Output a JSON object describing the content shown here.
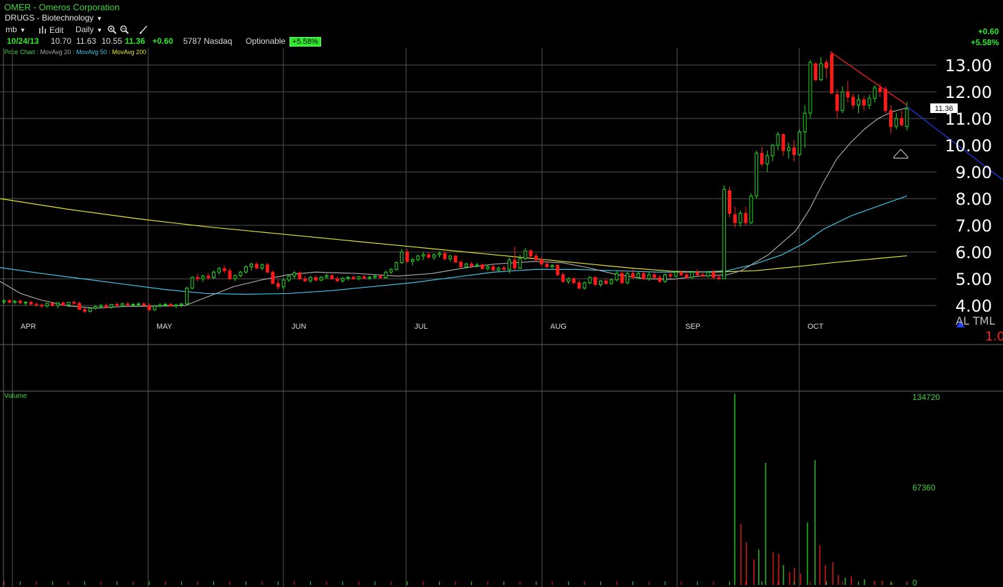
{
  "header": {
    "symbol": "OMER",
    "separator": "-",
    "company": "Omeros Corporation",
    "industry": "DRUGS - Biotechnology"
  },
  "toolbar": {
    "layout_label": "mb",
    "edit_label": "Edit",
    "period_label": "Daily"
  },
  "quote": {
    "date": "10/24/13",
    "open": "10.70",
    "high": "11.63",
    "low": "10.55",
    "last": "11.36",
    "change": "+0.60",
    "volume": "5787",
    "exchange": "Nasdaq",
    "optionable": "Optionable",
    "pct_change": "+5.58%"
  },
  "top_right": {
    "change": "+0.60",
    "pct_change": "+5.58%"
  },
  "legend": {
    "price": "Price Chart",
    "ma20": "MovAvg 20",
    "ma50": "MovAvg 50",
    "ma200": "MovAvg 200",
    "sep": ":"
  },
  "markers": {
    "al_tml": "AL TML",
    "ratio": "1.0",
    "current_price_tag": "11.36"
  },
  "colors": {
    "up": "#1fe01f",
    "down": "#ff1a1a",
    "ma20": "#a8a8a8",
    "ma50": "#3cc8e6",
    "ma200": "#e6e62a",
    "grid": "#555555",
    "trend_red": "#ff2020",
    "trend_blue": "#2040ff",
    "volume_label": "#3fd23f"
  },
  "chart_data": {
    "type": "candlestick",
    "title": "OMER - Omeros Corporation",
    "y_ticks": [
      "13.00",
      "12.00",
      "11.00",
      "10.00",
      "9.00",
      "8.00",
      "7.00",
      "6.00",
      "5.00",
      "4.00"
    ],
    "ylim": [
      3.8,
      13.6
    ],
    "month_labels": [
      "APR",
      "MAY",
      "JUN",
      "JUL",
      "AUG",
      "SEP",
      "OCT"
    ],
    "grid": true,
    "ohlc": [
      [
        4.14,
        4.22,
        4.05,
        4.18
      ],
      [
        4.18,
        4.24,
        4.08,
        4.12
      ],
      [
        4.12,
        4.2,
        4.04,
        4.16
      ],
      [
        4.16,
        4.22,
        4.06,
        4.1
      ],
      [
        4.1,
        4.16,
        4.0,
        4.12
      ],
      [
        4.12,
        4.18,
        4.02,
        4.05
      ],
      [
        4.05,
        4.12,
        3.94,
        4.02
      ],
      [
        4.02,
        4.08,
        3.9,
        3.98
      ],
      [
        3.98,
        4.1,
        3.92,
        4.08
      ],
      [
        4.08,
        4.14,
        3.96,
        4.0
      ],
      [
        4.0,
        4.12,
        3.9,
        4.1
      ],
      [
        4.1,
        4.16,
        3.98,
        4.02
      ],
      [
        4.02,
        4.14,
        3.94,
        4.12
      ],
      [
        4.12,
        4.2,
        4.04,
        4.08
      ],
      [
        4.08,
        4.14,
        3.86,
        3.85
      ],
      [
        3.85,
        3.92,
        3.72,
        3.78
      ],
      [
        3.78,
        3.92,
        3.74,
        3.9
      ],
      [
        3.9,
        4.0,
        3.84,
        3.96
      ],
      [
        3.96,
        4.06,
        3.9,
        4.0
      ],
      [
        4.0,
        4.08,
        3.9,
        3.94
      ],
      [
        3.94,
        4.06,
        3.88,
        4.04
      ],
      [
        4.04,
        4.12,
        3.96,
        4.0
      ],
      [
        4.0,
        4.1,
        3.94,
        4.06
      ],
      [
        4.06,
        4.14,
        3.98,
        4.02
      ],
      [
        4.02,
        4.1,
        3.94,
        4.04
      ],
      [
        4.04,
        4.12,
        3.96,
        4.06
      ],
      [
        4.06,
        4.12,
        3.98,
        4.0
      ],
      [
        4.0,
        4.08,
        3.8,
        3.84
      ],
      [
        3.84,
        4.0,
        3.8,
        3.98
      ],
      [
        3.98,
        4.08,
        3.92,
        4.02
      ],
      [
        4.02,
        4.1,
        3.96,
        4.04
      ],
      [
        4.04,
        4.1,
        3.96,
        3.98
      ],
      [
        3.98,
        4.06,
        3.9,
        4.02
      ],
      [
        4.02,
        4.08,
        3.94,
        4.06
      ],
      [
        4.06,
        4.7,
        4.02,
        4.65
      ],
      [
        4.65,
        5.1,
        4.6,
        5.05
      ],
      [
        5.05,
        5.2,
        4.9,
        5.0
      ],
      [
        5.0,
        5.15,
        4.88,
        5.1
      ],
      [
        5.1,
        5.22,
        4.96,
        5.04
      ],
      [
        5.04,
        5.3,
        5.0,
        5.25
      ],
      [
        5.25,
        5.45,
        5.15,
        5.38
      ],
      [
        5.38,
        5.5,
        5.2,
        5.3
      ],
      [
        5.3,
        5.4,
        4.95,
        5.0
      ],
      [
        5.0,
        5.16,
        4.9,
        5.12
      ],
      [
        5.12,
        5.3,
        5.06,
        5.25
      ],
      [
        5.25,
        5.5,
        5.2,
        5.45
      ],
      [
        5.45,
        5.6,
        5.3,
        5.55
      ],
      [
        5.55,
        5.62,
        5.35,
        5.4
      ],
      [
        5.4,
        5.58,
        5.32,
        5.52
      ],
      [
        5.52,
        5.6,
        5.2,
        5.25
      ],
      [
        5.25,
        5.3,
        4.8,
        4.82
      ],
      [
        4.82,
        5.0,
        4.6,
        4.7
      ],
      [
        4.7,
        5.0,
        4.6,
        4.95
      ],
      [
        4.95,
        5.15,
        4.88,
        5.1
      ],
      [
        5.1,
        5.3,
        5.0,
        5.22
      ],
      [
        5.22,
        5.28,
        4.95,
        5.0
      ],
      [
        5.0,
        5.1,
        4.88,
        4.92
      ],
      [
        4.92,
        5.1,
        4.86,
        5.05
      ],
      [
        5.05,
        5.12,
        4.9,
        4.95
      ],
      [
        4.95,
        5.1,
        4.9,
        5.06
      ],
      [
        5.06,
        5.2,
        5.0,
        5.12
      ],
      [
        5.12,
        5.18,
        4.95,
        5.0
      ],
      [
        5.0,
        5.08,
        4.88,
        4.92
      ],
      [
        4.92,
        5.06,
        4.86,
        5.02
      ],
      [
        5.02,
        5.1,
        4.94,
        5.06
      ],
      [
        5.06,
        5.12,
        4.96,
        5.0
      ],
      [
        5.0,
        5.1,
        4.94,
        5.08
      ],
      [
        5.08,
        5.14,
        4.98,
        5.02
      ],
      [
        5.02,
        5.1,
        4.96,
        5.06
      ],
      [
        5.06,
        5.16,
        5.0,
        5.1
      ],
      [
        5.1,
        5.16,
        5.0,
        5.04
      ],
      [
        5.04,
        5.3,
        5.0,
        5.25
      ],
      [
        5.25,
        5.4,
        5.18,
        5.35
      ],
      [
        5.35,
        5.65,
        5.3,
        5.6
      ],
      [
        5.6,
        6.1,
        5.55,
        6.0
      ],
      [
        6.0,
        6.1,
        5.6,
        5.65
      ],
      [
        5.65,
        5.78,
        5.5,
        5.72
      ],
      [
        5.72,
        5.9,
        5.65,
        5.85
      ],
      [
        5.85,
        6.0,
        5.7,
        5.9
      ],
      [
        5.9,
        6.0,
        5.75,
        5.8
      ],
      [
        5.8,
        5.95,
        5.7,
        5.9
      ],
      [
        5.9,
        6.02,
        5.8,
        5.95
      ],
      [
        5.95,
        6.02,
        5.7,
        5.75
      ],
      [
        5.75,
        5.9,
        5.65,
        5.85
      ],
      [
        5.85,
        5.9,
        5.6,
        5.62
      ],
      [
        5.62,
        5.7,
        5.4,
        5.45
      ],
      [
        5.45,
        5.6,
        5.38,
        5.55
      ],
      [
        5.55,
        5.62,
        5.4,
        5.48
      ],
      [
        5.48,
        5.6,
        5.42,
        5.52
      ],
      [
        5.52,
        5.58,
        5.35,
        5.38
      ],
      [
        5.38,
        5.5,
        5.3,
        5.45
      ],
      [
        5.45,
        5.52,
        5.3,
        5.32
      ],
      [
        5.32,
        5.45,
        5.26,
        5.4
      ],
      [
        5.4,
        5.5,
        5.3,
        5.35
      ],
      [
        5.35,
        5.8,
        5.2,
        5.7
      ],
      [
        5.7,
        6.2,
        5.3,
        5.4
      ],
      [
        5.4,
        5.9,
        5.36,
        5.75
      ],
      [
        5.75,
        6.15,
        5.7,
        6.05
      ],
      [
        6.05,
        6.1,
        5.8,
        5.85
      ],
      [
        5.85,
        5.95,
        5.65,
        5.72
      ],
      [
        5.72,
        5.8,
        5.5,
        5.55
      ],
      [
        5.55,
        5.62,
        5.4,
        5.45
      ],
      [
        5.45,
        5.55,
        5.38,
        5.5
      ],
      [
        5.5,
        5.55,
        5.1,
        5.15
      ],
      [
        5.15,
        5.25,
        4.85,
        4.9
      ],
      [
        4.9,
        5.05,
        4.82,
        5.0
      ],
      [
        5.0,
        5.05,
        4.8,
        4.85
      ],
      [
        4.85,
        4.95,
        4.6,
        4.65
      ],
      [
        4.65,
        4.9,
        4.6,
        4.85
      ],
      [
        4.85,
        5.1,
        4.8,
        5.05
      ],
      [
        5.05,
        5.1,
        4.75,
        4.78
      ],
      [
        4.78,
        4.95,
        4.7,
        4.92
      ],
      [
        4.92,
        5.0,
        4.78,
        4.82
      ],
      [
        4.82,
        5.0,
        4.78,
        4.96
      ],
      [
        4.96,
        5.3,
        4.9,
        5.2
      ],
      [
        5.2,
        5.3,
        4.8,
        4.85
      ],
      [
        4.85,
        5.25,
        4.8,
        5.2
      ],
      [
        5.2,
        5.35,
        5.0,
        5.05
      ],
      [
        5.05,
        5.25,
        5.0,
        5.2
      ],
      [
        5.2,
        5.3,
        4.95,
        5.0
      ],
      [
        5.0,
        5.25,
        4.92,
        5.15
      ],
      [
        5.15,
        5.25,
        5.0,
        5.05
      ],
      [
        5.05,
        5.15,
        4.85,
        4.9
      ],
      [
        4.9,
        5.2,
        4.85,
        5.15
      ],
      [
        5.15,
        5.3,
        5.0,
        5.1
      ],
      [
        5.1,
        5.28,
        5.05,
        5.25
      ],
      [
        5.25,
        5.3,
        5.1,
        5.15
      ],
      [
        5.15,
        5.3,
        5.0,
        5.05
      ],
      [
        5.05,
        5.3,
        5.0,
        5.25
      ],
      [
        5.25,
        5.35,
        5.1,
        5.15
      ],
      [
        5.15,
        5.3,
        5.05,
        5.1
      ],
      [
        5.1,
        5.3,
        5.05,
        5.25
      ],
      [
        5.25,
        5.35,
        5.0,
        5.05
      ],
      [
        5.05,
        5.15,
        4.95,
        5.0
      ],
      [
        5.0,
        8.5,
        5.0,
        8.35
      ],
      [
        8.3,
        8.45,
        7.3,
        7.45
      ],
      [
        7.4,
        7.7,
        6.9,
        7.1
      ],
      [
        7.1,
        7.55,
        6.95,
        7.45
      ],
      [
        7.45,
        7.7,
        7.0,
        7.1
      ],
      [
        7.1,
        8.2,
        7.05,
        8.1
      ],
      [
        8.1,
        9.8,
        8.0,
        9.7
      ],
      [
        9.7,
        9.95,
        9.2,
        9.3
      ],
      [
        9.3,
        9.8,
        9.0,
        9.6
      ],
      [
        9.6,
        10.05,
        9.4,
        10.0
      ],
      [
        10.0,
        10.5,
        9.8,
        10.4
      ],
      [
        10.4,
        10.45,
        9.6,
        9.8
      ],
      [
        9.8,
        10.1,
        9.5,
        9.9
      ],
      [
        9.9,
        10.2,
        9.4,
        9.65
      ],
      [
        9.65,
        10.6,
        9.6,
        10.5
      ],
      [
        10.5,
        11.5,
        9.9,
        11.2
      ],
      [
        11.2,
        13.2,
        11.0,
        13.1
      ],
      [
        13.05,
        13.1,
        12.4,
        12.45
      ],
      [
        12.45,
        13.3,
        12.4,
        13.05
      ],
      [
        13.1,
        13.2,
        12.5,
        12.9
      ],
      [
        13.4,
        13.5,
        11.9,
        11.95
      ],
      [
        11.9,
        12.1,
        11.0,
        11.3
      ],
      [
        11.3,
        12.2,
        11.2,
        12.0
      ],
      [
        12.0,
        12.4,
        11.6,
        11.8
      ],
      [
        11.8,
        11.95,
        11.35,
        11.5
      ],
      [
        11.5,
        11.9,
        11.2,
        11.7
      ],
      [
        11.7,
        11.85,
        11.3,
        11.5
      ],
      [
        11.5,
        11.9,
        11.35,
        11.75
      ],
      [
        11.75,
        12.25,
        11.6,
        12.15
      ],
      [
        12.15,
        12.3,
        11.8,
        12.0
      ],
      [
        12.1,
        12.2,
        11.2,
        11.3
      ],
      [
        11.3,
        11.5,
        10.45,
        10.7
      ],
      [
        10.7,
        11.2,
        10.6,
        11.0
      ],
      [
        11.0,
        11.3,
        10.7,
        10.76
      ],
      [
        10.7,
        11.63,
        10.55,
        11.36
      ]
    ],
    "ma20": [
      [
        0,
        4.9
      ],
      [
        30,
        4.45
      ],
      [
        60,
        4.2
      ],
      [
        100,
        3.98
      ],
      [
        140,
        3.9
      ],
      [
        180,
        3.96
      ],
      [
        240,
        3.98
      ],
      [
        270,
        4.0
      ],
      [
        300,
        4.3
      ],
      [
        340,
        4.7
      ],
      [
        380,
        4.95
      ],
      [
        420,
        5.15
      ],
      [
        460,
        5.25
      ],
      [
        520,
        5.2
      ],
      [
        580,
        5.1
      ],
      [
        630,
        5.2
      ],
      [
        680,
        5.42
      ],
      [
        720,
        5.55
      ],
      [
        780,
        5.65
      ],
      [
        820,
        5.6
      ],
      [
        860,
        5.4
      ],
      [
        900,
        5.15
      ],
      [
        940,
        5.0
      ],
      [
        980,
        4.98
      ],
      [
        1020,
        5.1
      ],
      [
        1060,
        5.15
      ],
      [
        1080,
        5.3
      ],
      [
        1120,
        5.9
      ],
      [
        1160,
        6.8
      ],
      [
        1180,
        7.6
      ],
      [
        1200,
        8.6
      ],
      [
        1220,
        9.5
      ],
      [
        1240,
        10.1
      ],
      [
        1260,
        10.6
      ],
      [
        1280,
        11.0
      ],
      [
        1300,
        11.25
      ],
      [
        1322,
        11.4
      ]
    ],
    "ma50": [
      [
        0,
        5.42
      ],
      [
        60,
        5.2
      ],
      [
        120,
        5.0
      ],
      [
        180,
        4.8
      ],
      [
        240,
        4.6
      ],
      [
        300,
        4.45
      ],
      [
        360,
        4.42
      ],
      [
        420,
        4.45
      ],
      [
        480,
        4.55
      ],
      [
        540,
        4.7
      ],
      [
        600,
        4.85
      ],
      [
        660,
        5.05
      ],
      [
        720,
        5.25
      ],
      [
        780,
        5.35
      ],
      [
        840,
        5.35
      ],
      [
        900,
        5.3
      ],
      [
        960,
        5.25
      ],
      [
        1020,
        5.25
      ],
      [
        1060,
        5.3
      ],
      [
        1100,
        5.55
      ],
      [
        1140,
        5.9
      ],
      [
        1170,
        6.3
      ],
      [
        1200,
        6.85
      ],
      [
        1240,
        7.35
      ],
      [
        1280,
        7.72
      ],
      [
        1322,
        8.1
      ]
    ],
    "ma200": [
      [
        0,
        8.0
      ],
      [
        100,
        7.6
      ],
      [
        200,
        7.25
      ],
      [
        300,
        6.95
      ],
      [
        400,
        6.7
      ],
      [
        500,
        6.45
      ],
      [
        600,
        6.2
      ],
      [
        700,
        5.95
      ],
      [
        800,
        5.7
      ],
      [
        860,
        5.55
      ],
      [
        920,
        5.4
      ],
      [
        980,
        5.28
      ],
      [
        1040,
        5.25
      ],
      [
        1100,
        5.3
      ],
      [
        1160,
        5.45
      ],
      [
        1220,
        5.62
      ],
      [
        1280,
        5.76
      ],
      [
        1322,
        5.86
      ]
    ],
    "trendlines": [
      {
        "color": "red",
        "points": [
          [
            1210,
            13.5
          ],
          [
            1322,
            11.5
          ]
        ]
      },
      {
        "color": "blue",
        "points": [
          [
            1322,
            11.45
          ],
          [
            1462,
            8.7
          ]
        ]
      }
    ],
    "volume": {
      "label": "Volume",
      "ticks": [
        "134720",
        "67360",
        "0"
      ],
      "ylim": [
        0,
        134720
      ],
      "spikes": [
        [
          1071,
          134720,
          "up"
        ],
        [
          1080,
          43000,
          "down"
        ],
        [
          1088,
          30000,
          "down"
        ],
        [
          1099,
          18000,
          "down"
        ],
        [
          1106,
          25000,
          "up"
        ],
        [
          1116,
          86000,
          "up"
        ],
        [
          1127,
          23000,
          "down"
        ],
        [
          1135,
          22000,
          "down"
        ],
        [
          1142,
          14000,
          "up"
        ],
        [
          1151,
          9000,
          "down"
        ],
        [
          1158,
          12000,
          "down"
        ],
        [
          1167,
          8000,
          "down"
        ],
        [
          1177,
          44000,
          "up"
        ],
        [
          1188,
          88000,
          "up"
        ],
        [
          1195,
          28000,
          "down"
        ],
        [
          1203,
          14000,
          "down"
        ],
        [
          1214,
          16000,
          "down"
        ],
        [
          1222,
          7000,
          "down"
        ],
        [
          1232,
          5000,
          "up"
        ],
        [
          1241,
          6000,
          "down"
        ],
        [
          1260,
          4000,
          "up"
        ],
        [
          1275,
          3000,
          "down"
        ],
        [
          1286,
          3000,
          "down"
        ],
        [
          1300,
          2000,
          "down"
        ],
        [
          1322,
          2000,
          "up"
        ]
      ]
    }
  }
}
